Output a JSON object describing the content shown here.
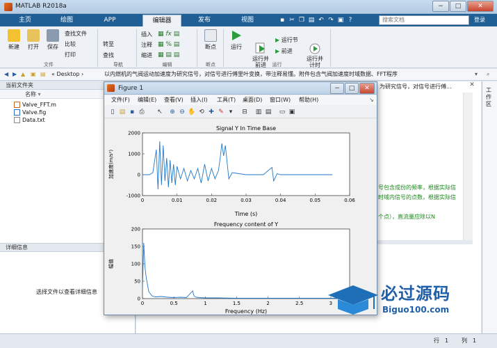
{
  "window": {
    "title": "MATLAB R2018a",
    "min_glyph": "−",
    "max_glyph": "□",
    "close_glyph": "✕"
  },
  "tabs": [
    {
      "label": "主页"
    },
    {
      "label": "绘图"
    },
    {
      "label": "APP"
    },
    {
      "label": "编辑器"
    },
    {
      "label": "发布"
    },
    {
      "label": "视图"
    }
  ],
  "search": {
    "placeholder": "搜索文档",
    "login": "登录"
  },
  "toolstrip": {
    "file": {
      "new": "新建",
      "open": "打开",
      "save": "保存",
      "find_files": "查找文件",
      "compare": "比较",
      "print": "打印",
      "group": "文件"
    },
    "navigate": {
      "goto": "转至",
      "find": "查找",
      "group": "导航"
    },
    "edit": {
      "insert": "插入",
      "comment": "注释",
      "indent": "缩进",
      "group": "编辑"
    },
    "breakpoints": {
      "label": "断点",
      "group": "断点"
    },
    "run": {
      "run": "运行",
      "run_advance": "运行并\n前进",
      "run_section": "运行节",
      "advance": "前进",
      "run_time": "运行并\n计时",
      "group": "运行"
    }
  },
  "address": {
    "path_prefix": "«  Desktop  ›",
    "path_rest": "以内燃机的气阀运动加速度为研究信号，对信号进行傅里叶变换，带注释易懂。附件包含气阀加速度时域数据、FFT程序"
  },
  "folder_panel": {
    "title": "当前文件夹",
    "column": "名称",
    "files": [
      {
        "name": "Valve_FFT.m"
      },
      {
        "name": "Valve.fig"
      },
      {
        "name": "Data.txt"
      }
    ]
  },
  "detail_panel": {
    "title": "详细信息",
    "empty_hint": "选择文件以查看详细信息"
  },
  "command_area": {
    "header_text": "为研究信号，对信号进行傅...",
    "lines": [
      "号包含成份的频率，根据实际信",
      "时域内信号的点数，根据实际信",
      "个点），直流量应除以N"
    ]
  },
  "workspace": {
    "label": "工作区"
  },
  "figure": {
    "title": "Figure 1",
    "menu": [
      "文件(F)",
      "编辑(E)",
      "查看(V)",
      "插入(I)",
      "工具(T)",
      "桌面(D)",
      "窗口(W)",
      "帮助(H)"
    ],
    "plot1": {
      "title": "Signal Y In Time Base",
      "ylabel": "加速度(m/s²)",
      "xlabel": "Time (s)",
      "xticks": [
        "0",
        "0.01",
        "0.02",
        "0.03",
        "0.04",
        "0.05",
        "0.06"
      ],
      "yticks": [
        "2000",
        "1000",
        "0",
        "-1000"
      ]
    },
    "plot2": {
      "title": "Frequency content of Y",
      "ylabel": "幅值",
      "xlabel": "Frequency (Hz)",
      "xticks": [
        "0",
        "0.5",
        "1",
        "1.5",
        "2",
        "2.5",
        "3"
      ],
      "yticks": [
        "200",
        "150",
        "100",
        "50",
        "0"
      ]
    }
  },
  "chart_data": [
    {
      "type": "line",
      "title": "Signal Y In Time Base",
      "xlabel": "Time (s)",
      "ylabel": "加速度(m/s²)",
      "xlim": [
        0,
        0.06
      ],
      "ylim": [
        -1000,
        2000
      ],
      "series": [
        {
          "x": [
            0,
            0.002,
            0.003,
            0.004,
            0.0045,
            0.005,
            0.0055,
            0.006,
            0.0065,
            0.007,
            0.0075,
            0.008,
            0.0085,
            0.009,
            0.0095,
            0.01,
            0.011,
            0.012,
            0.013,
            0.014,
            0.015,
            0.016,
            0.017,
            0.018,
            0.019,
            0.02,
            0.021,
            0.022,
            0.0225,
            0.023,
            0.0235,
            0.024,
            0.025,
            0.026,
            0.03,
            0.035,
            0.0375,
            0.038,
            0.039,
            0.04,
            0.045,
            0.05,
            0.055
          ],
          "y": [
            0,
            0,
            100,
            1200,
            -700,
            1600,
            -500,
            1400,
            -300,
            800,
            -600,
            700,
            -400,
            500,
            -500,
            400,
            -200,
            300,
            -300,
            200,
            -200,
            300,
            -400,
            500,
            -300,
            300,
            -200,
            200,
            800,
            1500,
            900,
            1400,
            -200,
            100,
            0,
            0,
            350,
            -300,
            50,
            0,
            0,
            0,
            0
          ]
        }
      ]
    },
    {
      "type": "line",
      "title": "Frequency content of Y",
      "xlabel": "Frequency (Hz)",
      "ylabel": "幅值",
      "xlim": [
        0,
        3.3
      ],
      "ylim": [
        0,
        200
      ],
      "series": [
        {
          "x": [
            0,
            0.02,
            0.04,
            0.06,
            0.08,
            0.1,
            0.15,
            0.2,
            0.3,
            0.4,
            0.5,
            0.6,
            0.7,
            0.8,
            0.82,
            0.85,
            0.9,
            1.0,
            1.2,
            1.5,
            2.0,
            2.5,
            3.0,
            3.3
          ],
          "y": [
            30,
            160,
            90,
            60,
            40,
            20,
            8,
            5,
            6,
            4,
            3,
            4,
            3,
            22,
            8,
            4,
            3,
            2,
            2,
            1,
            1,
            1,
            1,
            1
          ]
        }
      ]
    }
  ],
  "watermark": {
    "brand": "必过源码",
    "url": "Biguo100.com"
  },
  "statusbar": {
    "row_label": "行",
    "row": "1",
    "col_label": "列",
    "col": "1"
  }
}
